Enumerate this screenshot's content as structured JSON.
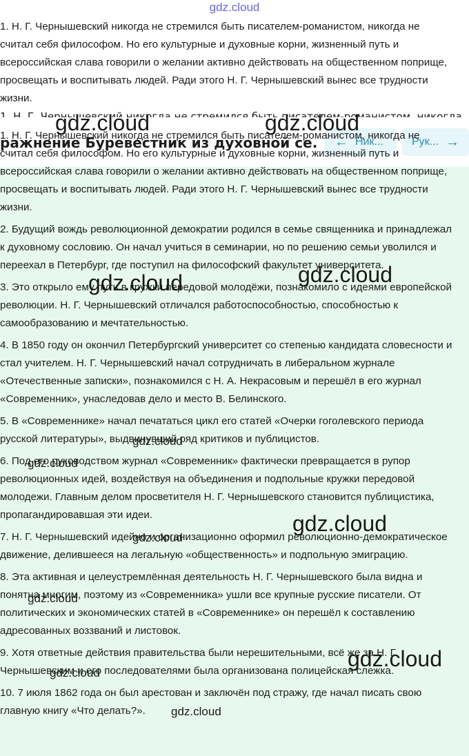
{
  "watermark_text": "gdz.cloud",
  "header": {
    "title": "ражнение Буревестник из духовной се...",
    "prev_label": "Ник...",
    "next_label": "Рук..."
  },
  "paragraphs": [
    "1. Н. Г. Чернышевский никогда не стремился быть писателем-романистом, никогда не считал себя философом. Но его культурные и духовные корни, жизненный путь и всероссийская слава говорили о желании активно действовать на общественном поприще, просвещать и воспитывать людей. Ради этого Н. Г. Чернышевский вынес все трудности жизни.",
    "2. Будущий вождь революционной демократии родился в семье священника и принадлежал к духовному сословию. Он начал учиться в семинарии, но по решению семьи уволился и переехал в Петербург, где поступил на философский факультет университета.",
    "3. Это открыло ему путь в кружки передовой молодёжи, познакомило с идеями европейской революции. Н. Г. Чернышевский отличался работоспособностью, способностью к самообразованию и мечтательностью.",
    "4. В 1850 году он окончил Петербургский университет со степенью кандидата словесности и стал учителем. Н. Г. Чернышевский начал сотрудничать в либеральном журнале «Отечественные записки», познакомился с Н. А. Некрасовым и перешёл в его журнал «Современник», унаследовав дело и место В. Белинского.",
    "5. В «Современнике» начал печататься цикл его статей «Очерки гоголевского периода русской литературы», выдвинувший ряд критиков и публицистов.",
    "6. Под его руководством журнал «Современник» фактически превращается в рупор революционных идей, воздействуя на объединения и подпольные кружки передовой молодежи. Главным делом просветителя Н. Г. Чернышевского становится публицистика, пропагандировавшая эти идеи.",
    "7. Н. Г. Чернышевский идейно и организационно оформил революционно-демократическое движение, делившееся на легальную «общественность» и подпольную эмиграцию.",
    "8. Эта активная и целеустремлённая деятельность Н. Г. Чернышевского была видна и понятна многим, поэтому из «Современника» ушли все крупные русские писатели. От политических и экономических статей в «Современнике» он перешёл к составлению адресованных воззваний и листовок.",
    "9. Хотя ответные действия правительства были нерешительными, всё же за Н. Г. Чернышевским и его последователями была организована полицейская слежка.",
    "10. 7 июля 1862 года он был арестован и заключён под стражу, где начал писать свою главную книгу «Что делать?»."
  ],
  "colors": {
    "content_bg": "#e7f8ee",
    "nav_button_bg": "#e6f6fa",
    "nav_button_text": "#2c8fb0",
    "top_watermark": "#6b63e0"
  }
}
